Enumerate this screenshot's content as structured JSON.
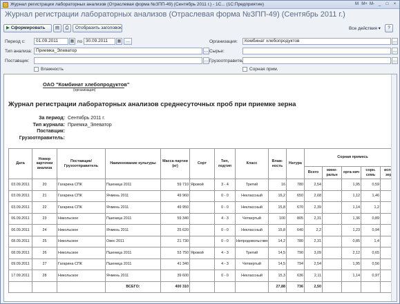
{
  "window": {
    "title": "Журнал регистрации лабораторных анализов (Отраслевая форма №ЗПП-49) (Сентябрь 2011 г.) - 1С... (1С:Предприятие)",
    "controls": [
      "M",
      "M+",
      "M-",
      "_",
      "□",
      "×"
    ]
  },
  "heading": "Журнал регистрации лабораторных анализов (Отраслевая форма №ЗПП-49) (Сентябрь 2011 г.)",
  "toolbar": {
    "generate_label": "Сформировать",
    "show_header_label": "Отобразить заголовок",
    "all_actions_label": "Все действия ▾"
  },
  "form": {
    "period_from_label": "Период с:",
    "period_from": "01.09.2011",
    "period_to_label": "по",
    "period_to": "30.09.2011",
    "org_label": "Организация:",
    "org_value": "Комбинат хлебопродуктов",
    "analysis_type_label": "Тип анализа:",
    "analysis_type_value": "Приемка_Элеватор",
    "raw_label": "Сырье:",
    "raw_value": "",
    "supplier_label": "Поставщик:",
    "supplier_value": "",
    "shipper_label": "Грузоотправитель:",
    "shipper_value": "",
    "moisture_label": "Влажность",
    "weed_label": "Сорная прим."
  },
  "report": {
    "org_name": "ОАО \"Комбинат хлебопродуктов\"",
    "org_caption": "(организация)",
    "title": "Журнал регистрации лабораторных анализов среднесуточных проб при приемке зерна",
    "info": [
      {
        "key": "За период:",
        "value": "Сентябрь 2011 г."
      },
      {
        "key": "Тип журнала:",
        "value": "Приемка_Элеватор"
      },
      {
        "key": "Поставщик:",
        "value": ""
      },
      {
        "key": "Грузоотправитель:",
        "value": ""
      }
    ],
    "columns": {
      "date": "Дата",
      "card": "Номер карточки анализа",
      "supplier": "Поставщик/ Грузоотправитель",
      "crop": "Наименование культуры",
      "mass": "Масса партии (кг)",
      "sort": "Сорт",
      "type": "Тип, подтип",
      "class": "Класс",
      "moisture": "Влаж-ность",
      "nature": "Натура",
      "weed_group": "Сорная примесь",
      "weed_total": "Всего",
      "weed_mineral": "мине-ральн",
      "weed_organic": "орга-нич",
      "weed_seeds": "сорн. семь",
      "weed_spoiled": "испорч зерен"
    },
    "rows": [
      {
        "date": "03.09.2011",
        "card": "20",
        "supplier": "Гагарина СПК",
        "crop": "Пшеница 2011",
        "mass": "59 710",
        "sort": "Яровой",
        "type": "3 - 4",
        "class": "Третий",
        "moisture": "16",
        "nature": "780",
        "total": "2,54",
        "mineral": "",
        "organic": "1,95",
        "seeds": "0,59",
        "spoiled": ""
      },
      {
        "date": "03.09.2011",
        "card": "21",
        "supplier": "Гагарина СПК",
        "crop": "Ячмень 2011",
        "mass": "49 960",
        "sort": "",
        "type": "0 - 0",
        "class": "Неклассный",
        "moisture": "16,2",
        "nature": "650",
        "total": "2,68",
        "mineral": "",
        "organic": "1,12",
        "seeds": "1,46",
        "spoiled": ""
      },
      {
        "date": "03.09.2011",
        "card": "22",
        "supplier": "Гагарина СПК",
        "crop": "Ячмень 2011",
        "mass": "49 950",
        "sort": "",
        "type": "0 - 0",
        "class": "Неклассный",
        "moisture": "15,8",
        "nature": "670",
        "total": "2,39",
        "mineral": "",
        "organic": "1,14",
        "seeds": "1,2",
        "spoiled": ""
      },
      {
        "date": "06.09.2011",
        "card": "23",
        "supplier": "Никольское",
        "crop": "Пшеница 2011",
        "mass": "59 340",
        "sort": "",
        "type": "4 - 3",
        "class": "Четвертый",
        "moisture": "100",
        "nature": "805",
        "total": "2,31",
        "mineral": "",
        "organic": "1,36",
        "seeds": "0,89",
        "spoiled": ""
      },
      {
        "date": "06.09.2011",
        "card": "24",
        "supplier": "Никольское",
        "crop": "Ячмень 2011",
        "mass": "25 620",
        "sort": "",
        "type": "0 - 0",
        "class": "Неклассный",
        "moisture": "15,8",
        "nature": "640",
        "total": "2,2",
        "mineral": "",
        "organic": "1,23",
        "seeds": "0,94",
        "spoiled": ""
      },
      {
        "date": "08.09.2011",
        "card": "25",
        "supplier": "Никольское",
        "crop": "Овес 2011",
        "mass": "21 730",
        "sort": "",
        "type": "0 - 0",
        "class": "Непродовольственный",
        "moisture": "14,2",
        "nature": "780",
        "total": "2,31",
        "mineral": "",
        "organic": "0,85",
        "seeds": "1,4",
        "spoiled": ""
      },
      {
        "date": "08.09.2011",
        "card": "26",
        "supplier": "Никольское",
        "crop": "Пшеница 2011",
        "mass": "53 750",
        "sort": "Яровой",
        "type": "4 - 3",
        "class": "Третий",
        "moisture": "14,5",
        "nature": "790",
        "total": "3,09",
        "mineral": "",
        "organic": "2,12",
        "seeds": "0,65",
        "spoiled": ""
      },
      {
        "date": "09.09.2011",
        "card": "27",
        "supplier": "Гагарина СПК",
        "crop": "Пшеница 2011",
        "mass": "41 340",
        "sort": "",
        "type": "4 - 3",
        "class": "Четвертый",
        "moisture": "14,5",
        "nature": "794",
        "total": "2,54",
        "mineral": "",
        "organic": "1,95",
        "seeds": "0,56",
        "spoiled": ""
      },
      {
        "date": "17.09.2011",
        "card": "28",
        "supplier": "Никольское",
        "crop": "Ячмень 2011",
        "mass": "39 600",
        "sort": "",
        "type": "0 - 0",
        "class": "Неклассный",
        "moisture": "15,3",
        "nature": "636",
        "total": "2,11",
        "mineral": "",
        "organic": "1,14",
        "seeds": "0,97",
        "spoiled": ""
      }
    ],
    "total": {
      "label": "ВСЕГО:",
      "mass": "400 310",
      "moisture": "27,88",
      "nature": "736",
      "weed_total": "2,50"
    }
  }
}
